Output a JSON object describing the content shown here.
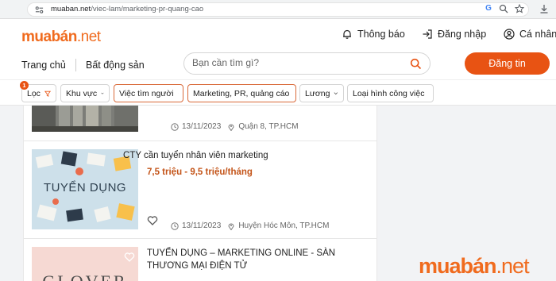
{
  "browser": {
    "url_domain": "muaban.net",
    "url_path": "/viec-lam/marketing-pr-quang-cao"
  },
  "header": {
    "logo_main": "muabán",
    "logo_suffix": ".net",
    "links": {
      "notifications": "Thông báo",
      "login": "Đăng nhập",
      "account": "Cá nhân"
    },
    "nav": [
      "Trang chủ",
      "Bất động sản"
    ],
    "search_placeholder": "Bạn cần tìm gì?",
    "post_button": "Đăng tin"
  },
  "filters": {
    "badge_count": "1",
    "items": [
      {
        "label": "Lọc",
        "icon": "funnel-icon",
        "active": false
      },
      {
        "label": "Khu vực",
        "icon": "chevron-down-icon",
        "active": false
      },
      {
        "label": "Việc tìm người",
        "icon": "chevron-down-icon",
        "active": true
      },
      {
        "label": "Marketing, PR, quảng cáo",
        "icon": "chevron-down-icon",
        "active": true
      },
      {
        "label": "Lương",
        "icon": "chevron-down-icon",
        "active": false
      },
      {
        "label": "Loại hình công việc",
        "icon": "chevron-down-icon",
        "active": false
      }
    ]
  },
  "listings": [
    {
      "date": "13/11/2023",
      "location": "Quận 8, TP.HCM"
    },
    {
      "title": "CTY cần tuyển nhân viên marketing",
      "salary": "7,5 triệu - 9,5 triệu/tháng",
      "thumb_text": "TUYỂN DỤNG",
      "date": "13/11/2023",
      "location": "Huyện Hóc Môn, TP.HCM"
    },
    {
      "title": "TUYỂN DỤNG – MARKETING ONLINE - SÀN THƯƠNG MẠI ĐIỆN TỬ",
      "thumb_text": "GLOVER"
    }
  ],
  "watermark": {
    "main": "muabán",
    "suffix": ".net"
  },
  "colors": {
    "brand": "#f06b1e",
    "button": "#e85313",
    "salary": "#c4551a"
  }
}
